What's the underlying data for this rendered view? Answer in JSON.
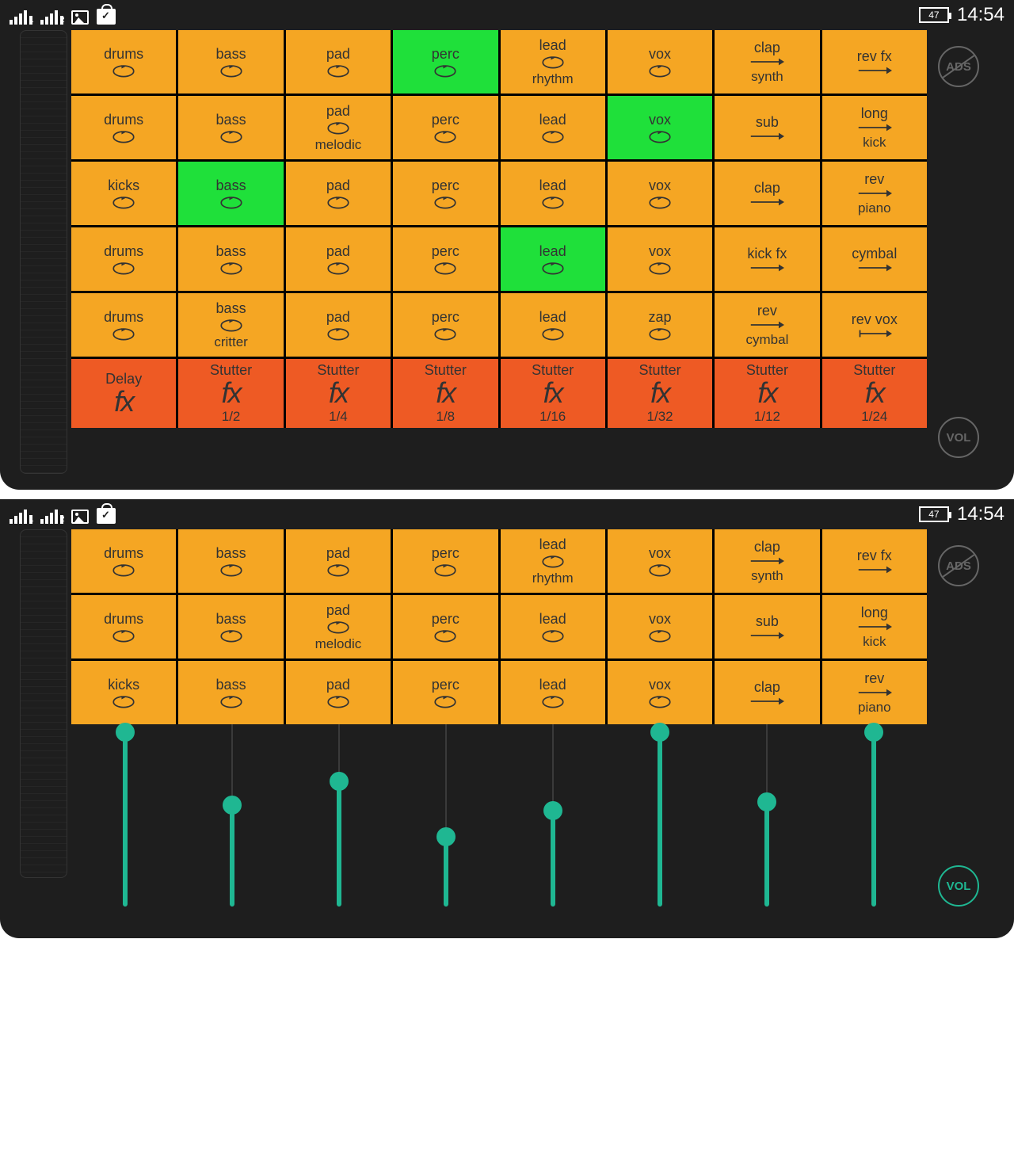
{
  "status": {
    "battery": "47",
    "time": "14:54"
  },
  "labels": {
    "ads": "ADS",
    "vol": "VOL",
    "fx": "fx"
  },
  "shot1": {
    "rows": [
      [
        {
          "t": "drums",
          "icon": "loop"
        },
        {
          "t": "bass",
          "icon": "loop"
        },
        {
          "t": "pad",
          "icon": "loop"
        },
        {
          "t": "perc",
          "icon": "loop",
          "active": true
        },
        {
          "t": "lead",
          "icon": "loop",
          "b": "rhythm"
        },
        {
          "t": "vox",
          "icon": "loop"
        },
        {
          "t": "clap",
          "icon": "arrow",
          "b": "synth"
        },
        {
          "t": "rev fx",
          "icon": "arrow"
        }
      ],
      [
        {
          "t": "drums",
          "icon": "loop"
        },
        {
          "t": "bass",
          "icon": "loop"
        },
        {
          "t": "pad",
          "icon": "loop",
          "b": "melodic"
        },
        {
          "t": "perc",
          "icon": "loop"
        },
        {
          "t": "lead",
          "icon": "loop"
        },
        {
          "t": "vox",
          "icon": "loop",
          "active": true
        },
        {
          "t": "sub",
          "icon": "arrow"
        },
        {
          "t": "long",
          "icon": "arrow",
          "b": "kick"
        }
      ],
      [
        {
          "t": "kicks",
          "icon": "loop"
        },
        {
          "t": "bass",
          "icon": "loop",
          "active": true
        },
        {
          "t": "pad",
          "icon": "loop"
        },
        {
          "t": "perc",
          "icon": "loop"
        },
        {
          "t": "lead",
          "icon": "loop"
        },
        {
          "t": "vox",
          "icon": "loop"
        },
        {
          "t": "clap",
          "icon": "arrow"
        },
        {
          "t": "rev",
          "icon": "arrow",
          "b": "piano"
        }
      ],
      [
        {
          "t": "drums",
          "icon": "loop"
        },
        {
          "t": "bass",
          "icon": "loop"
        },
        {
          "t": "pad",
          "icon": "loop"
        },
        {
          "t": "perc",
          "icon": "loop"
        },
        {
          "t": "lead",
          "icon": "loop",
          "active": true
        },
        {
          "t": "vox",
          "icon": "loop"
        },
        {
          "t": "kick fx",
          "icon": "arrow"
        },
        {
          "t": "cymbal",
          "icon": "arrow"
        }
      ],
      [
        {
          "t": "drums",
          "icon": "loop"
        },
        {
          "t": "bass",
          "icon": "loop",
          "b": "critter"
        },
        {
          "t": "pad",
          "icon": "loop"
        },
        {
          "t": "perc",
          "icon": "loop"
        },
        {
          "t": "lead",
          "icon": "loop"
        },
        {
          "t": "zap",
          "icon": "loop"
        },
        {
          "t": "rev",
          "icon": "arrow",
          "b": "cymbal"
        },
        {
          "t": "rev vox",
          "icon": "once"
        }
      ]
    ],
    "fxrow": [
      {
        "t": "Delay",
        "b": ""
      },
      {
        "t": "Stutter",
        "b": "1/2"
      },
      {
        "t": "Stutter",
        "b": "1/4"
      },
      {
        "t": "Stutter",
        "b": "1/8"
      },
      {
        "t": "Stutter",
        "b": "1/16"
      },
      {
        "t": "Stutter",
        "b": "1/32"
      },
      {
        "t": "Stutter",
        "b": "1/12"
      },
      {
        "t": "Stutter",
        "b": "1/24"
      }
    ]
  },
  "shot2": {
    "rows": [
      [
        {
          "t": "drums",
          "icon": "loop"
        },
        {
          "t": "bass",
          "icon": "loop"
        },
        {
          "t": "pad",
          "icon": "loop"
        },
        {
          "t": "perc",
          "icon": "loop"
        },
        {
          "t": "lead",
          "icon": "loop",
          "b": "rhythm"
        },
        {
          "t": "vox",
          "icon": "loop"
        },
        {
          "t": "clap",
          "icon": "arrow",
          "b": "synth"
        },
        {
          "t": "rev fx",
          "icon": "arrow"
        }
      ],
      [
        {
          "t": "drums",
          "icon": "loop"
        },
        {
          "t": "bass",
          "icon": "loop"
        },
        {
          "t": "pad",
          "icon": "loop",
          "b": "melodic"
        },
        {
          "t": "perc",
          "icon": "loop"
        },
        {
          "t": "lead",
          "icon": "loop"
        },
        {
          "t": "vox",
          "icon": "loop"
        },
        {
          "t": "sub",
          "icon": "arrow"
        },
        {
          "t": "long",
          "icon": "arrow",
          "b": "kick"
        }
      ],
      [
        {
          "t": "kicks",
          "icon": "loop"
        },
        {
          "t": "bass",
          "icon": "loop"
        },
        {
          "t": "pad",
          "icon": "loop"
        },
        {
          "t": "perc",
          "icon": "loop"
        },
        {
          "t": "lead",
          "icon": "loop"
        },
        {
          "t": "vox",
          "icon": "loop"
        },
        {
          "t": "clap",
          "icon": "arrow"
        },
        {
          "t": "rev",
          "icon": "arrow",
          "b": "piano"
        }
      ]
    ],
    "faders": [
      100,
      58,
      72,
      40,
      55,
      100,
      60,
      100
    ]
  }
}
